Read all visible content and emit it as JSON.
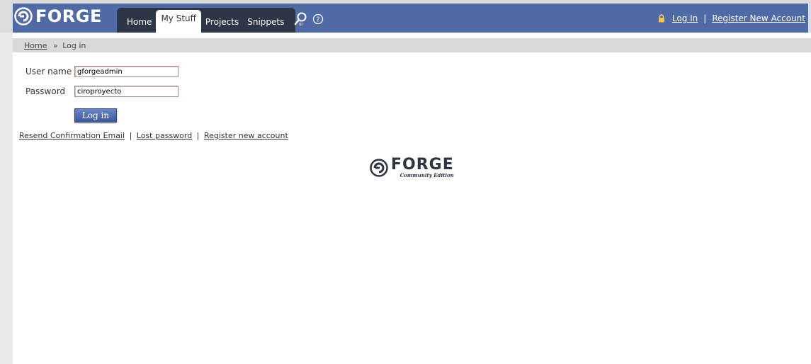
{
  "brand": {
    "logo_text": "FORGE",
    "footer_logo_text": "FORGE",
    "footer_logo_sub": "Community Edition"
  },
  "nav": {
    "tabs": [
      {
        "label": "Home"
      },
      {
        "label": "My Stuff"
      },
      {
        "label": "Projects"
      },
      {
        "label": "Snippets"
      }
    ],
    "active_tab": "My Stuff"
  },
  "auth": {
    "login_label": "Log In",
    "separator": "|",
    "register_label": "Register New Account"
  },
  "breadcrumb": {
    "home": "Home",
    "separator": "»",
    "current": "Log in"
  },
  "form": {
    "username_label": "User name",
    "username_value": "gforgeadmin",
    "password_label": "Password",
    "password_value": "ciroproyecto",
    "submit_label": "Log in"
  },
  "links": {
    "resend": "Resend Confirmation Email",
    "lost": "Lost password",
    "register": "Register new account",
    "separator": "|"
  },
  "icons": [
    "forge-logo-icon",
    "search-icon",
    "help-icon",
    "lock-icon"
  ],
  "colors": {
    "header_bg": "#506aa6",
    "tabs_bg": "#2c3646",
    "button_bg": "#3d579b"
  }
}
